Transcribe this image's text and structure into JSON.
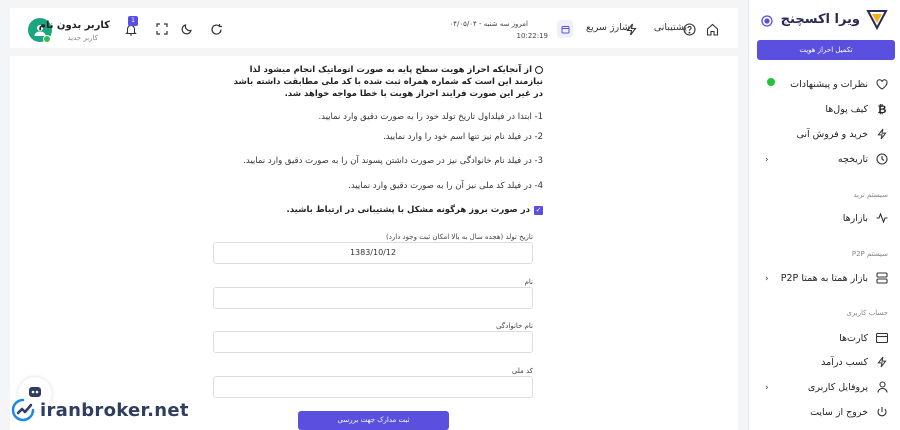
{
  "header": {
    "user_name": "کاربر بدون نام",
    "user_role": "کاربر جدید",
    "notification_count": "1",
    "date_text": "امروز سه شنبه - ۰۴/۰۵/۰۴",
    "time_text": "10:22:19",
    "quick_charge": "شارژ سریع",
    "support": "پشتیبانی"
  },
  "content": {
    "notice": "از آنجایکه احراز هویت سطح پایه به صورت اتوماتیک انجام میشود لذا نیازمند این است که شماره همراه ثبت شده با کد ملی مطابقت داشته باشد در غیر این صورت فرایند احراز هویت با خطا مواجه خواهد شد.",
    "steps": [
      "1- ابتدا در فیلداول تاریخ تولد خود را به صورت دقیق وارد نمایید.",
      "2- در فیلد نام نیز تنها اسم خود را وارد نمایید.",
      "3- در فیلد نام خانوادگی نیز در صورت داشتن پسوند آن را به صورت دقیق وارد نمایید.",
      "4- در فیلد کد ملی نیز آن را به صورت دقیق وارد نمایید."
    ],
    "contact_support": "در صورت بروز هرگونه مشکل با پشتیبانی در ارتباط باشید.",
    "fields": {
      "birth_label": "تاریخ تولد (هجده سال به بالا امکان ثبت وجود دارد)",
      "birth_value": "1383/10/12",
      "first_name_label": "نام",
      "first_name_value": "",
      "last_name_label": "نام خانوادگی",
      "last_name_value": "",
      "national_code_label": "کد ملی",
      "national_code_value": ""
    },
    "submit_label": "ثبت مدارک جهت بررسی"
  },
  "sidebar": {
    "brand": "ویرا اکسچنج",
    "kyc_button": "تکمیل احراز هویت",
    "items": {
      "feedback": "نظرات و پیشنهادات",
      "wallets": "کیف پول‌ها",
      "buy_sell": "خرید و فروش آنی",
      "history": "تاریخچه",
      "markets": "بازارها",
      "p2p_market": "بازار همتا به همتا P2P",
      "cards": "کارت‌ها",
      "earn": "کسب درآمد",
      "profile": "پروفایل کاربری",
      "logout": "خروج از سایت"
    },
    "sections": {
      "trade_system": "سیستم ترید",
      "p2p_system": "سیستم P2P",
      "account": "حساب کاربری"
    }
  },
  "watermark": "iranbroker.net",
  "colors": {
    "accent": "#5b4fe0",
    "online": "#21c43a",
    "avatar": "#1aa680"
  }
}
